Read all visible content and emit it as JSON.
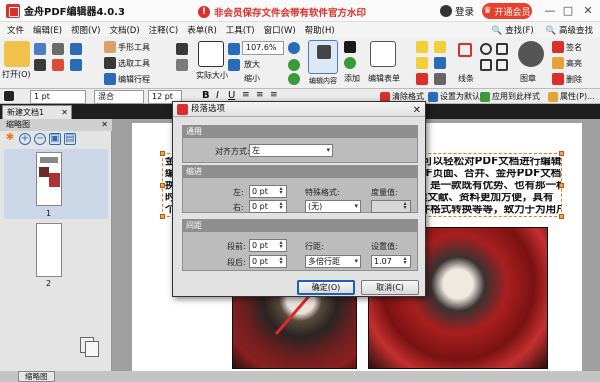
{
  "app": {
    "title": "金舟PDF编辑器4.0.3",
    "warning": "非会员保存文件会带有软件官方水印",
    "login": "登录",
    "vip": "开通会员"
  },
  "window_controls": {
    "minimize": "—",
    "maximize": "□",
    "close": "✕"
  },
  "menu": [
    "文件",
    "编辑(E)",
    "视图(V)",
    "文档(D)",
    "注释(C)",
    "表单(R)",
    "工具(T)",
    "窗口(W)",
    "帮助(H)"
  ],
  "menu_right": [
    "查找(F)",
    "高级查找"
  ],
  "ribbon": {
    "open": "打开(O)",
    "hand_tool": "手形工具",
    "select_tool": "选取工具",
    "edit_content": "编辑行程",
    "actual_size": "实际大小",
    "zoom_value": "107.6%",
    "zoom_in": "放大",
    "zoom_out": "缩小",
    "edit_content_tool": "编辑内容",
    "add": "添加",
    "edit_form": "编辑表单",
    "line": "线条",
    "stamp": "图章",
    "signature": "签名",
    "highlight": "高亮",
    "underline": "下划线",
    "strikeout": "删除"
  },
  "formatbar": {
    "stroke": "1 pt",
    "blend": "混合",
    "size": "12 pt",
    "clear_format": "清除格式",
    "set_default": "设置为默认",
    "apply_hint": "应用到此样式",
    "properties": "属性(P)..."
  },
  "tabs": {
    "doc": "新建文档1"
  },
  "panel": {
    "title": "缩略图",
    "pages": [
      "1",
      "2"
    ],
    "bottom_tab": "缩略图"
  },
  "document": {
    "lines": [
      "金舟PDF编辑器是一款非常好用的PDF编辑软件，用户可以轻松对PDF文档进行编辑，",
      "编辑、修改，以及对PDF文档加密、页面排版、整合PDF页面、合并、金舟PDF文档，属于",
      "换PDF编辑器软件，适合各行业人士在日常学习中使用，是一款既有优势、也有那一种，",
      "时的便捷高效、节省时间与精力、有效帮助用户快速阅读文献、资料更加方便，具有",
      "个及多个PDF页面的编辑工具，修改更加便捷，支持文件格式转换等等，致力于为用户提供一"
    ]
  },
  "dialog": {
    "title": "段落选项",
    "close": "✕",
    "general": {
      "header": "通用",
      "align_label": "对齐方式:",
      "align_value": "左"
    },
    "indent": {
      "header": "缩进",
      "left_label": "左:",
      "left_value": "0 pt",
      "right_label": "右:",
      "right_value": "0 pt",
      "special_label": "特殊格式:",
      "special_value": "(无)",
      "amount_label": "度量值:",
      "amount_value": ""
    },
    "spacing": {
      "header": "间距",
      "before_label": "段前:",
      "before_value": "0 pt",
      "after_label": "段后:",
      "after_value": "0 pt",
      "line_label": "行距:",
      "line_value": "多倍行距",
      "set_label": "设置值:",
      "set_value": "1.07"
    },
    "ok": "确定(O)",
    "cancel": "取消(C)"
  },
  "colors": {
    "accent": "#d9302a",
    "vip": "#e8402c",
    "handle": "#f6a24a",
    "frame": "#e8781e",
    "arrow": "#e02a2a"
  }
}
